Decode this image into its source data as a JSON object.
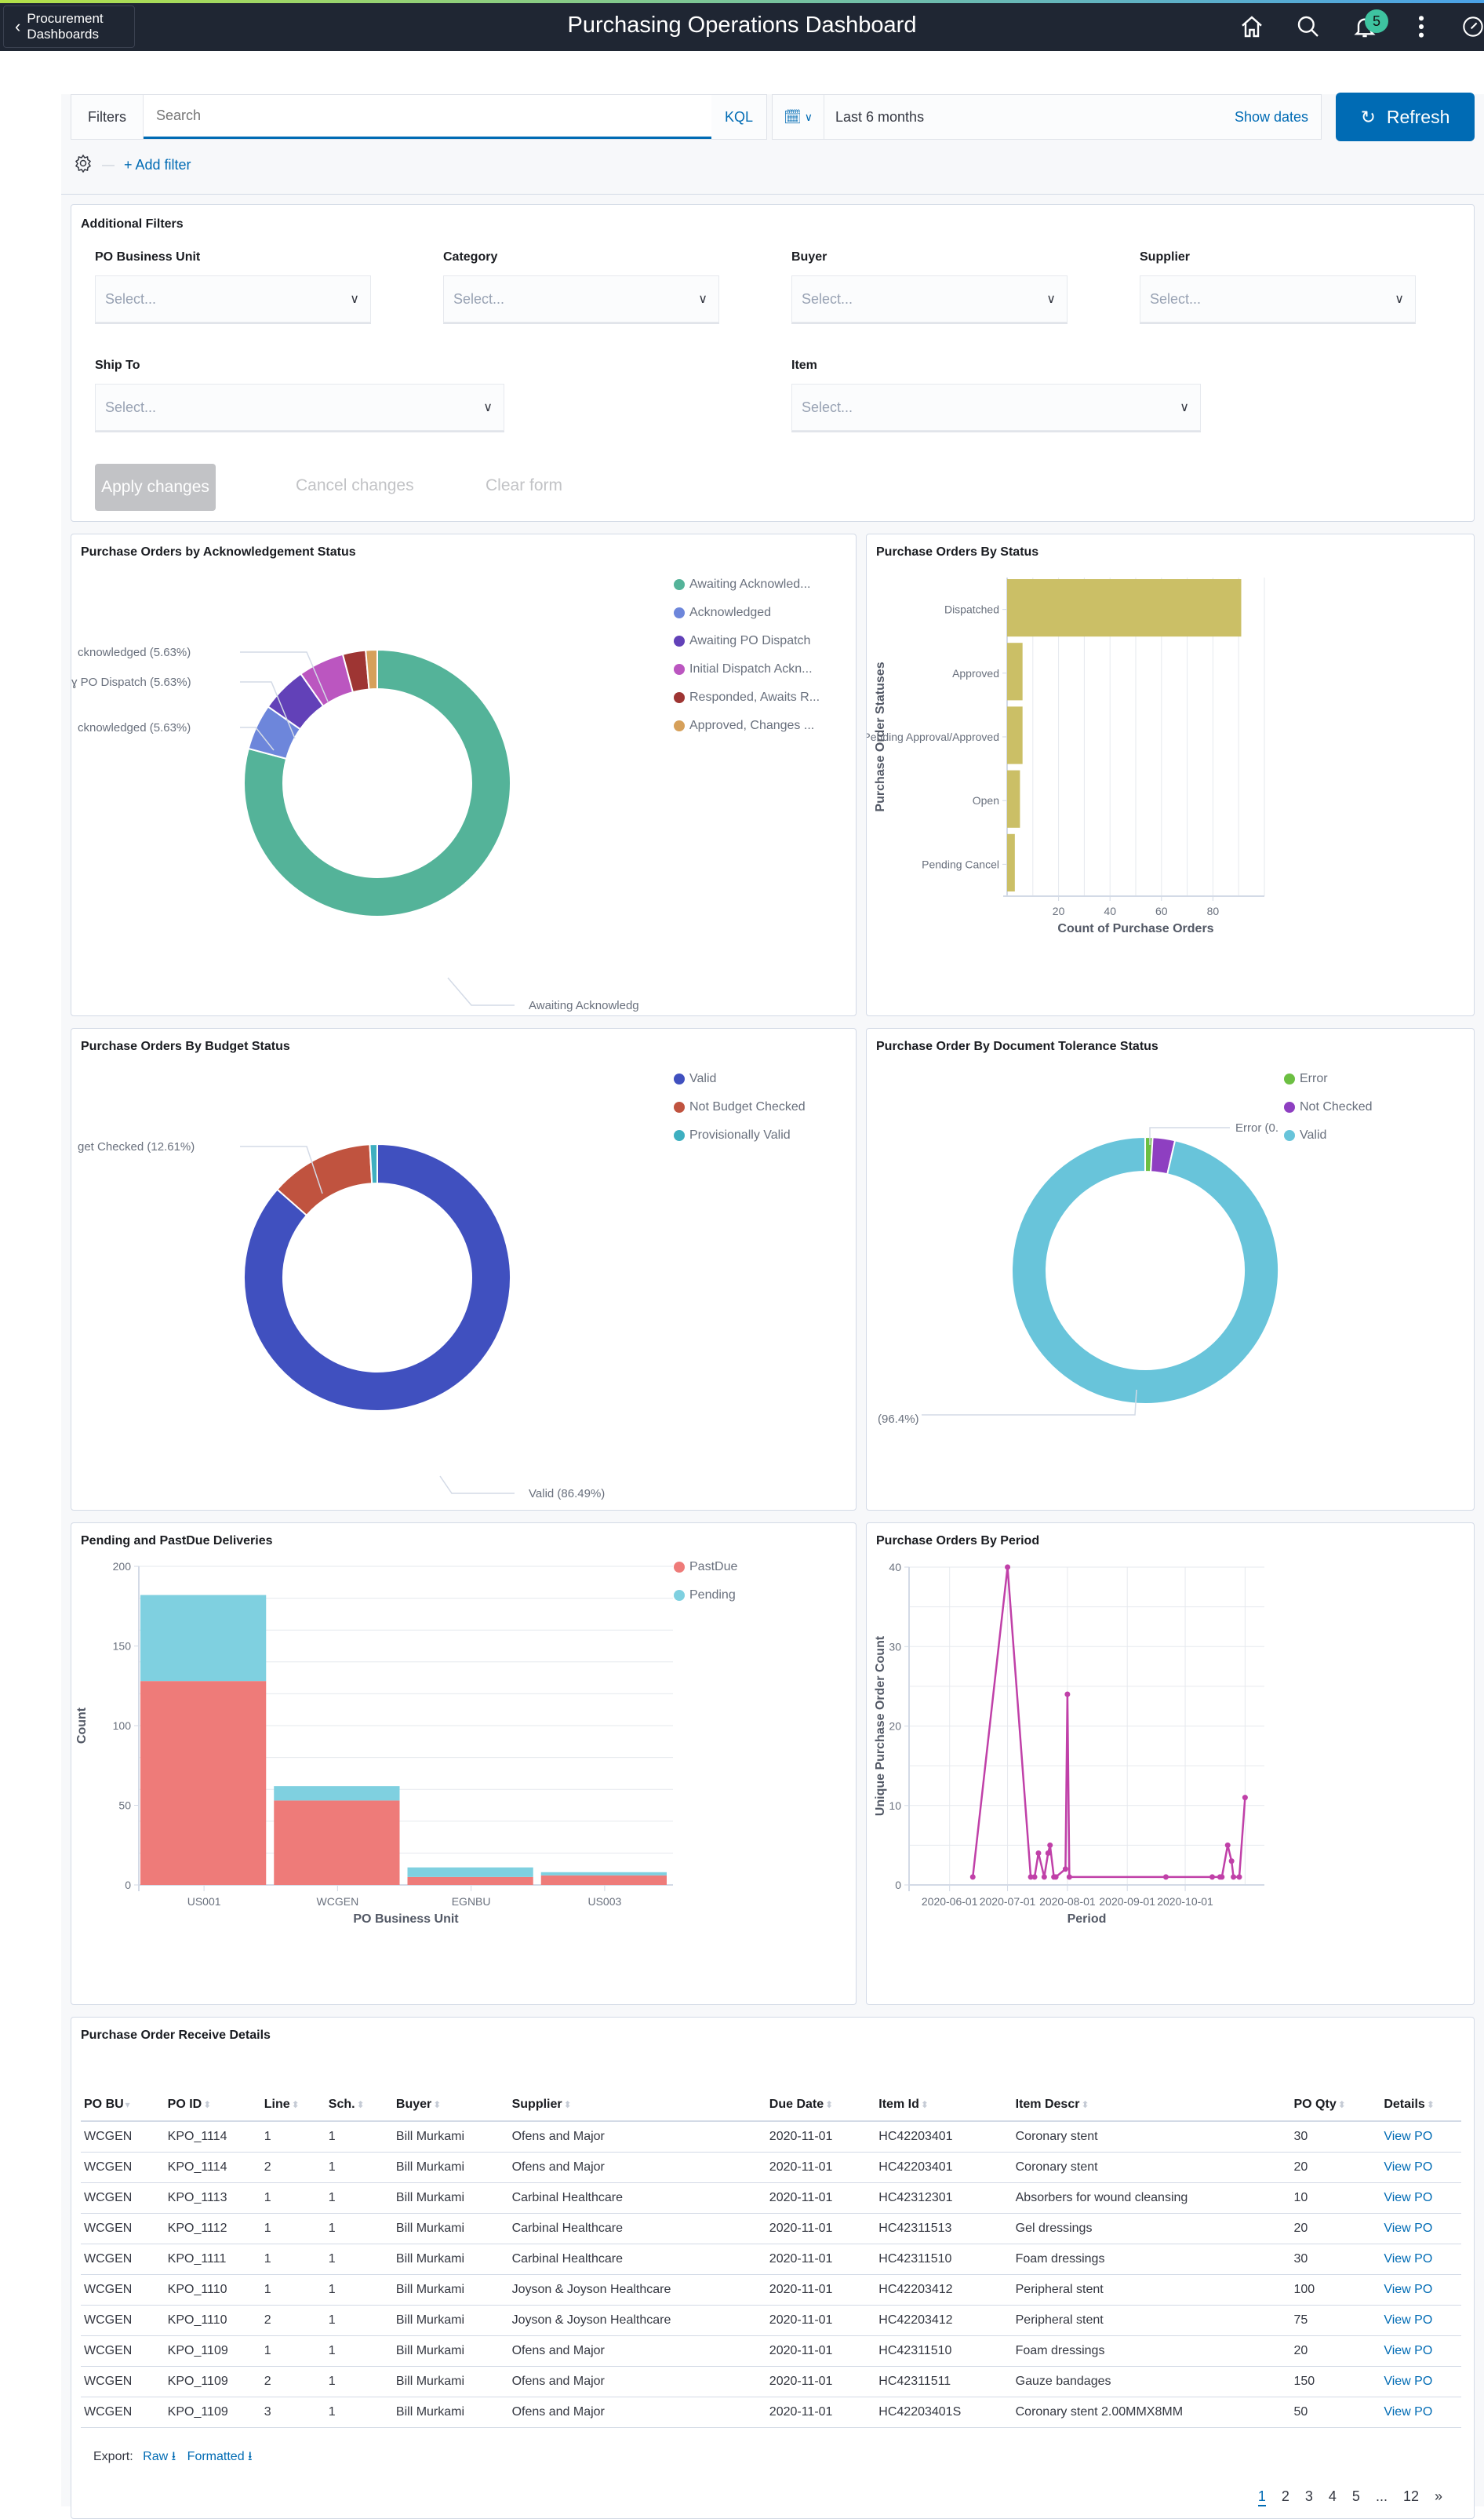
{
  "header": {
    "back_label": "Procurement Dashboards",
    "title": "Purchasing Operations Dashboard",
    "notification_count": "5",
    "icons": [
      "home-icon",
      "search-icon",
      "bell-icon",
      "more-icon",
      "compass-icon"
    ]
  },
  "query_bar": {
    "filters_label": "Filters",
    "search_placeholder": "Search",
    "kql_label": "KQL",
    "date_range": "Last 6 months",
    "show_dates_label": "Show dates",
    "refresh_label": "Refresh",
    "add_filter_label": "+ Add filter"
  },
  "additional_filters": {
    "title": "Additional Filters",
    "fields": [
      {
        "label": "PO Business Unit",
        "placeholder": "Select..."
      },
      {
        "label": "Category",
        "placeholder": "Select..."
      },
      {
        "label": "Buyer",
        "placeholder": "Select..."
      },
      {
        "label": "Supplier",
        "placeholder": "Select..."
      },
      {
        "label": "Ship To",
        "placeholder": "Select..."
      },
      {
        "label": "Item",
        "placeholder": "Select..."
      }
    ],
    "apply_label": "Apply changes",
    "cancel_label": "Cancel changes",
    "clear_label": "Clear form"
  },
  "chart_data": [
    {
      "id": "ack",
      "type": "pie",
      "donut": true,
      "title": "Purchase Orders by Acknowledgement Status",
      "labels": [
        "Awaiting Acknowledgement",
        "Acknowledged",
        "Awaiting PO Dispatch",
        "Initial Dispatch Acknowledged",
        "Responded, Awaits Review",
        "Approved, Changes Pending"
      ],
      "legend_labels": [
        "Awaiting Acknowled...",
        "Acknowledged",
        "Awaiting PO Dispatch",
        "Initial Dispatch Ackn...",
        "Responded, Awaits R...",
        "Approved, Changes ..."
      ],
      "values": [
        80.3,
        5.63,
        5.63,
        5.63,
        2.82,
        1.41
      ],
      "colors": [
        "#54b399",
        "#6d86db",
        "#6241b8",
        "#bb56c0",
        "#9e3533",
        "#d6a05a"
      ],
      "slice_labels": [
        "Awaiting Acknowledg",
        "cknowledged (5.63%)",
        "PO Dispatch (5.63%)",
        "cknowledged (5.63%)"
      ],
      "legend_position": "right"
    },
    {
      "id": "status",
      "type": "bar",
      "orientation": "horizontal",
      "title": "Purchase Orders By Status",
      "categories": [
        "Dispatched",
        "Approved",
        "Pending Approval/Approved",
        "Open",
        "Pending Cancel"
      ],
      "values": [
        91,
        6,
        6,
        5,
        3
      ],
      "xlabel": "Count of Purchase Orders",
      "ylabel": "Purchase Order Statuses",
      "xlim": [
        0,
        100
      ],
      "xticks": [
        20,
        40,
        60,
        80
      ],
      "color": "#cbbf66",
      "grid": true
    },
    {
      "id": "budget",
      "type": "pie",
      "donut": true,
      "title": "Purchase Orders By Budget Status",
      "labels": [
        "Valid",
        "Not Budget Checked",
        "Provisionally Valid"
      ],
      "legend_labels": [
        "Valid",
        "Not Budget Checked",
        "Provisionally Valid"
      ],
      "values": [
        86.49,
        12.61,
        0.9
      ],
      "colors": [
        "#4050bf",
        "#c0533f",
        "#3eafc0"
      ],
      "slice_labels": [
        "Valid (86.49%)",
        "get Checked (12.61%)"
      ],
      "legend_position": "right"
    },
    {
      "id": "tolerance",
      "type": "pie",
      "donut": true,
      "title": "Purchase Order By Document Tolerance Status",
      "labels": [
        "Error",
        "Not Checked",
        "Valid"
      ],
      "legend_labels": [
        "Error",
        "Not Checked",
        "Valid"
      ],
      "values": [
        0.9,
        2.7,
        96.4
      ],
      "colors": [
        "#6cbf42",
        "#8e3fc1",
        "#68c4da"
      ],
      "slice_labels": [
        "Error (0.",
        "(96.4%)"
      ],
      "legend_position": "right"
    },
    {
      "id": "deliveries",
      "type": "bar",
      "stacked": true,
      "title": "Pending and PastDue Deliveries",
      "categories": [
        "US001",
        "WCGEN",
        "EGNBU",
        "US003"
      ],
      "series": [
        {
          "name": "PastDue",
          "values": [
            128,
            53,
            5,
            6
          ],
          "color": "#ee7b79"
        },
        {
          "name": "Pending",
          "values": [
            54,
            9,
            6,
            2
          ],
          "color": "#7fd0e0"
        }
      ],
      "xlabel": "PO Business Unit",
      "ylabel": "Count",
      "ylim": [
        0,
        200
      ],
      "yticks": [
        0,
        50,
        100,
        150,
        200
      ],
      "grid": true,
      "legend_position": "top-right"
    },
    {
      "id": "period",
      "type": "line",
      "title": "Purchase Orders By Period",
      "x": [
        "2020-06-13",
        "2020-07-01",
        "2020-07-13",
        "2020-07-15",
        "2020-07-17",
        "2020-07-20",
        "2020-07-22",
        "2020-07-23",
        "2020-07-25",
        "2020-07-26",
        "2020-07-31",
        "2020-08-01",
        "2020-08-02",
        "2020-09-21",
        "2020-10-15",
        "2020-10-19",
        "2020-10-20",
        "2020-10-23",
        "2020-10-25",
        "2020-10-26",
        "2020-10-29",
        "2020-11-01"
      ],
      "values": [
        1,
        40,
        1,
        1,
        4,
        1,
        4,
        5,
        1,
        1,
        2,
        24,
        1,
        1,
        1,
        1,
        1,
        5,
        3,
        1,
        1,
        11
      ],
      "xlabel": "Period",
      "ylabel": "Unique Purchase Order Count",
      "xlim": [
        "2020-05-11",
        "2020-11-11"
      ],
      "xticks": [
        "2020-06-01",
        "2020-07-01",
        "2020-08-01",
        "2020-09-01",
        "2020-10-01"
      ],
      "ylim": [
        0,
        40
      ],
      "yticks": [
        0,
        10,
        20,
        30,
        40
      ],
      "color": "#c040a8",
      "grid": true
    }
  ],
  "table": {
    "title": "Purchase Order Receive Details",
    "columns": [
      "PO BU",
      "PO ID",
      "Line",
      "Sch.",
      "Buyer",
      "Supplier",
      "Due Date",
      "Item Id",
      "Item Descr",
      "PO Qty",
      "Details"
    ],
    "rows": [
      [
        "WCGEN",
        "KPO_1114",
        "1",
        "1",
        "Bill Murkami",
        "Ofens and Major",
        "2020-11-01",
        "HC42203401",
        "Coronary stent",
        "30",
        "View PO"
      ],
      [
        "WCGEN",
        "KPO_1114",
        "2",
        "1",
        "Bill Murkami",
        "Ofens and Major",
        "2020-11-01",
        "HC42203401",
        "Coronary stent",
        "20",
        "View PO"
      ],
      [
        "WCGEN",
        "KPO_1113",
        "1",
        "1",
        "Bill Murkami",
        "Carbinal Healthcare",
        "2020-11-01",
        "HC42312301",
        "Absorbers for wound cleansing",
        "10",
        "View PO"
      ],
      [
        "WCGEN",
        "KPO_1112",
        "1",
        "1",
        "Bill Murkami",
        "Carbinal Healthcare",
        "2020-11-01",
        "HC42311513",
        "Gel dressings",
        "20",
        "View PO"
      ],
      [
        "WCGEN",
        "KPO_1111",
        "1",
        "1",
        "Bill Murkami",
        "Carbinal Healthcare",
        "2020-11-01",
        "HC42311510",
        "Foam dressings",
        "30",
        "View PO"
      ],
      [
        "WCGEN",
        "KPO_1110",
        "1",
        "1",
        "Bill Murkami",
        "Joyson & Joyson Healthcare",
        "2020-11-01",
        "HC42203412",
        "Peripheral stent",
        "100",
        "View PO"
      ],
      [
        "WCGEN",
        "KPO_1110",
        "2",
        "1",
        "Bill Murkami",
        "Joyson & Joyson Healthcare",
        "2020-11-01",
        "HC42203412",
        "Peripheral stent",
        "75",
        "View PO"
      ],
      [
        "WCGEN",
        "KPO_1109",
        "1",
        "1",
        "Bill Murkami",
        "Ofens and Major",
        "2020-11-01",
        "HC42311510",
        "Foam dressings",
        "20",
        "View PO"
      ],
      [
        "WCGEN",
        "KPO_1109",
        "2",
        "1",
        "Bill Murkami",
        "Ofens and Major",
        "2020-11-01",
        "HC42311511",
        "Gauze bandages",
        "150",
        "View PO"
      ],
      [
        "WCGEN",
        "KPO_1109",
        "3",
        "1",
        "Bill Murkami",
        "Ofens and Major",
        "2020-11-01",
        "HC42203401S",
        "Coronary stent 2.00MMX8MM",
        "50",
        "View PO"
      ]
    ],
    "export_label": "Export:",
    "export_raw": "Raw",
    "export_formatted": "Formatted",
    "pages": [
      "1",
      "2",
      "3",
      "4",
      "5",
      "...",
      "12",
      "»"
    ],
    "current_page": "1"
  }
}
